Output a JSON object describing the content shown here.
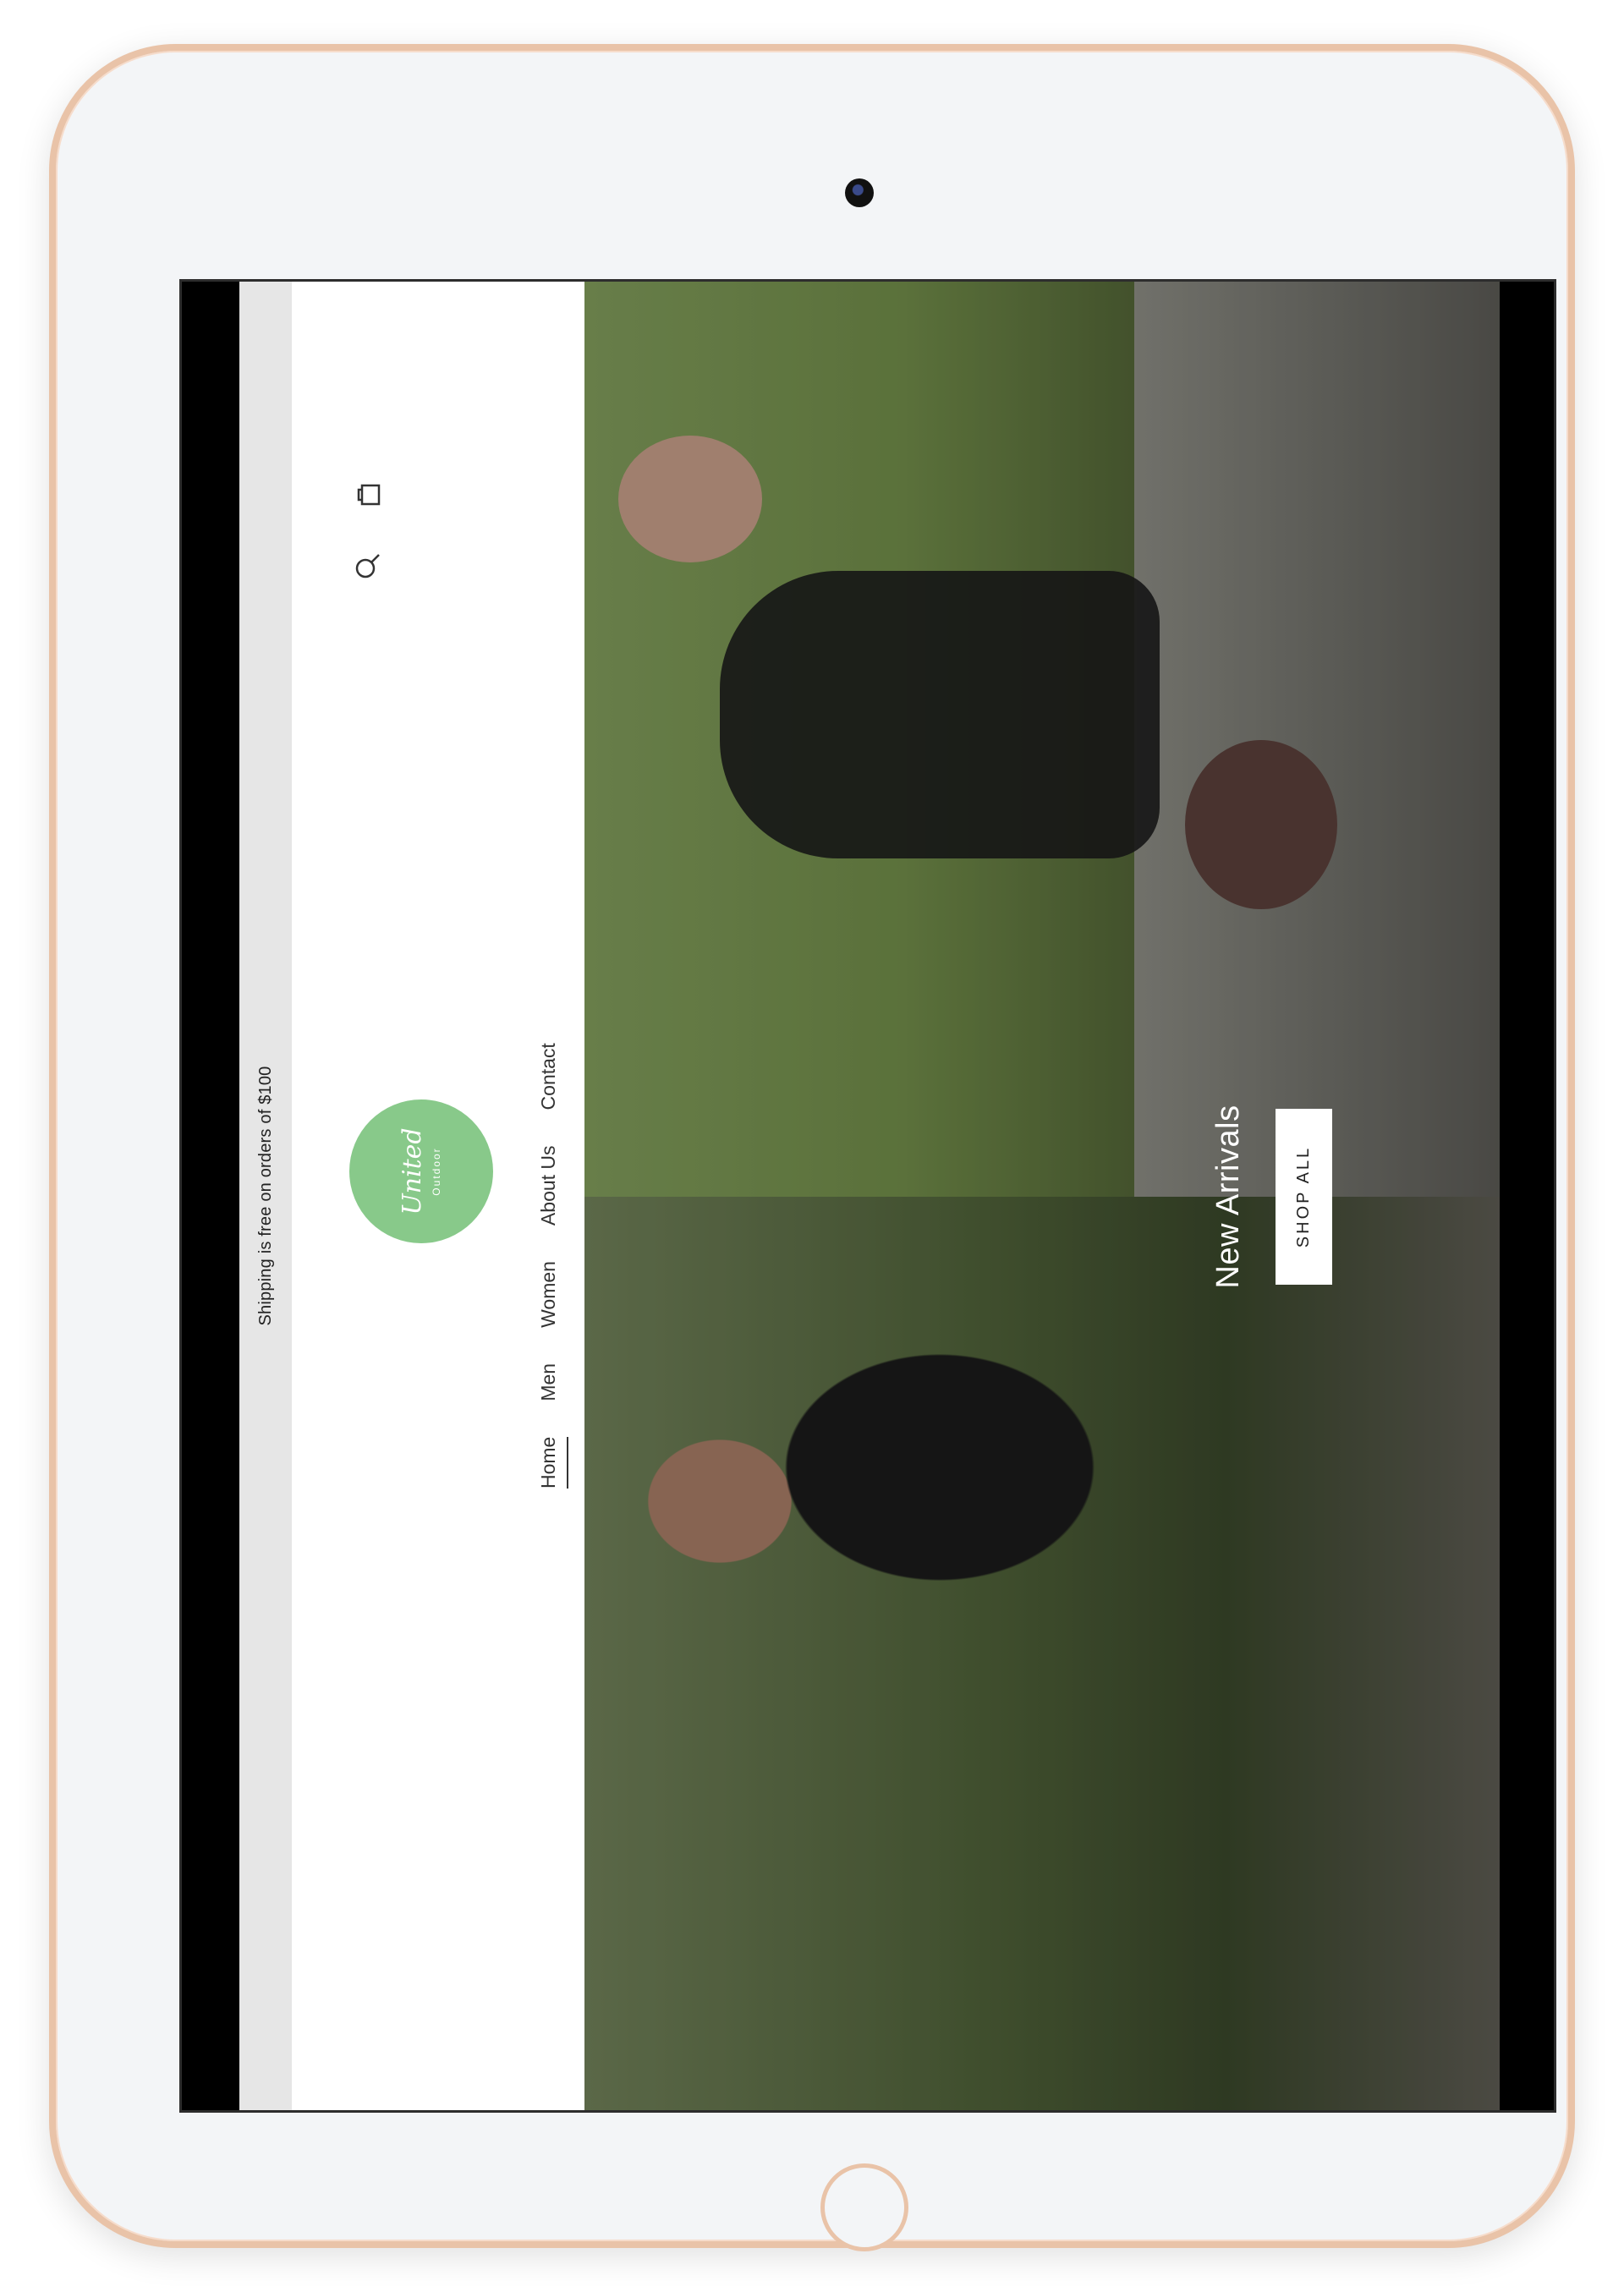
{
  "announcement": {
    "text": "Shipping is free on orders of $100"
  },
  "brand": {
    "logo_script": "United",
    "logo_sub": "Outdoor",
    "accent_color": "#88c98a"
  },
  "header": {
    "icons": [
      "search-icon",
      "cart-icon"
    ]
  },
  "nav": {
    "items": [
      {
        "label": "Home"
      },
      {
        "label": "Men"
      },
      {
        "label": "Women"
      },
      {
        "label": "About Us"
      },
      {
        "label": "Contact"
      }
    ],
    "active_index": 0
  },
  "hero": {
    "title": "New Arrivals",
    "button_label": "SHOP ALL"
  },
  "device": {
    "frame_color": "#e9c3a8",
    "bezel_color": "#f3f5f7"
  }
}
